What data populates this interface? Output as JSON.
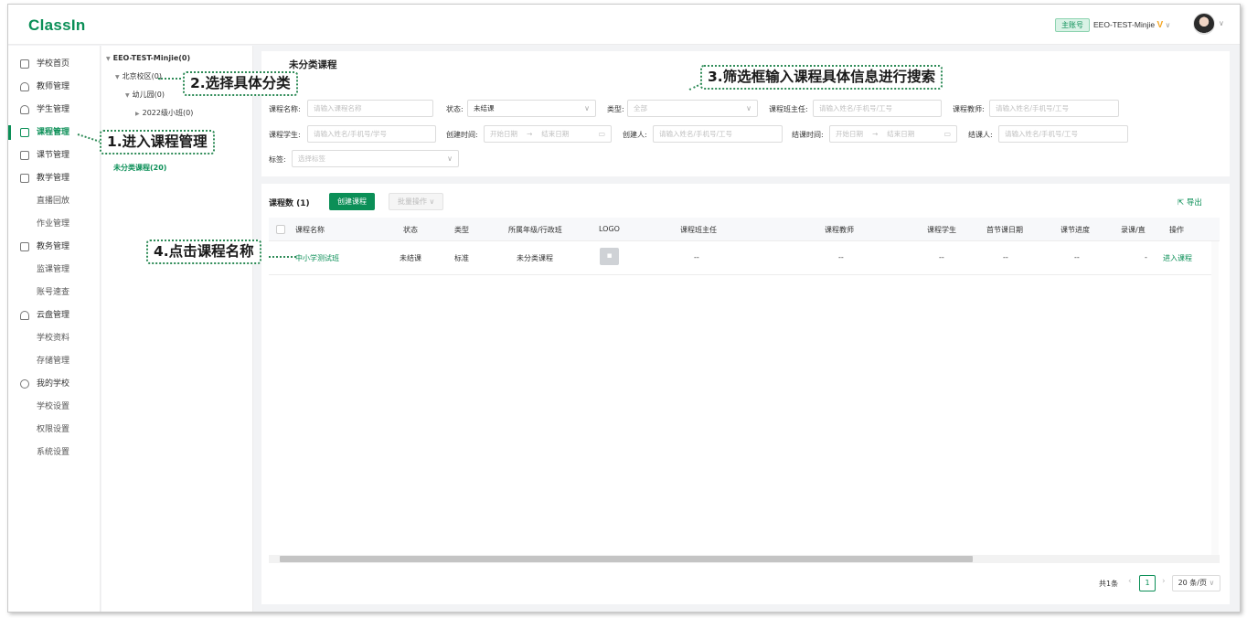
{
  "header": {
    "logo": "ClassIn",
    "account_badge": "主账号",
    "account_name": "EEO-TEST-Minjie",
    "vip_mark": "V",
    "caret": "∨"
  },
  "sidebar": {
    "items": [
      {
        "label": "学校首页",
        "icon": "home-icon"
      },
      {
        "label": "教师管理",
        "icon": "person-icon"
      },
      {
        "label": "学生管理",
        "icon": "group-icon"
      },
      {
        "label": "课程管理",
        "icon": "grid-icon",
        "active": true
      },
      {
        "label": "课节管理",
        "icon": "calendar-icon"
      },
      {
        "label": "教学管理",
        "icon": "book-icon"
      },
      {
        "label": "直播回放"
      },
      {
        "label": "作业管理"
      },
      {
        "label": "教务管理",
        "icon": "clipboard-icon"
      },
      {
        "label": "监课管理"
      },
      {
        "label": "账号速查"
      },
      {
        "label": "云盘管理",
        "icon": "cloud-icon"
      },
      {
        "label": "学校资料"
      },
      {
        "label": "存储管理"
      },
      {
        "label": "我的学校",
        "icon": "school-icon"
      },
      {
        "label": "学校设置"
      },
      {
        "label": "权限设置"
      },
      {
        "label": "系统设置"
      }
    ]
  },
  "tree": {
    "root": "EEO-TEST-Minjie(0)",
    "campus": "北京校区(0)",
    "kindergarten": "幼儿园(0)",
    "class": "2022级小班(0)",
    "uncategorized": "未分类课程(20)"
  },
  "breadcrumb": "未分类课程",
  "filters": {
    "course_name": {
      "label": "课程名称:",
      "placeholder": "请输入课程名称"
    },
    "status": {
      "label": "状态:",
      "value": "未结课"
    },
    "type": {
      "label": "类型:",
      "value": "全部"
    },
    "head_teacher": {
      "label": "课程班主任:",
      "placeholder": "请输入姓名/手机号/工号"
    },
    "teacher": {
      "label": "课程教师:",
      "placeholder": "请输入姓名/手机号/工号"
    },
    "student": {
      "label": "课程学生:",
      "placeholder": "请输入姓名/手机号/学号"
    },
    "created_time": {
      "label": "创建时间:",
      "start": "开始日期",
      "end": "结束日期"
    },
    "creator": {
      "label": "创建人:",
      "placeholder": "请输入姓名/手机号/工号"
    },
    "closed_time": {
      "label": "结课时间:",
      "start": "开始日期",
      "end": "结束日期"
    },
    "closer": {
      "label": "结课人:",
      "placeholder": "请输入姓名/手机号/工号"
    },
    "tags": {
      "label": "标签:",
      "placeholder": "选择标签"
    },
    "range_arrow": "→"
  },
  "toolbar": {
    "count_label": "课程数 (1)",
    "create_button": "创建课程",
    "batch_button": "批量操作",
    "export": "导出"
  },
  "table": {
    "columns": [
      "课程名称",
      "状态",
      "类型",
      "所属年级/行政班",
      "LOGO",
      "课程班主任",
      "课程教师",
      "课程学生",
      "首节课日期",
      "课节进度",
      "录课/直",
      "操作"
    ],
    "rows": [
      {
        "name": "中小学测试班",
        "status": "未结课",
        "type": "标准",
        "grade": "未分类课程",
        "head_teacher": "--",
        "teacher": "--",
        "student": "--",
        "first_date": "--",
        "progress": "--",
        "record": "-",
        "action": "进入课程"
      }
    ]
  },
  "pagination": {
    "total": "共1条",
    "current_page": "1",
    "page_size": "20 条/页"
  },
  "callouts": {
    "step1": "1.进入课程管理",
    "step2": "2.选择具体分类",
    "step3": "3.筛选框输入课程具体信息进行搜索",
    "step4": "4.点击课程名称"
  },
  "colors": {
    "brand": "#0b8f57",
    "callout_border": "#2e8b57"
  }
}
